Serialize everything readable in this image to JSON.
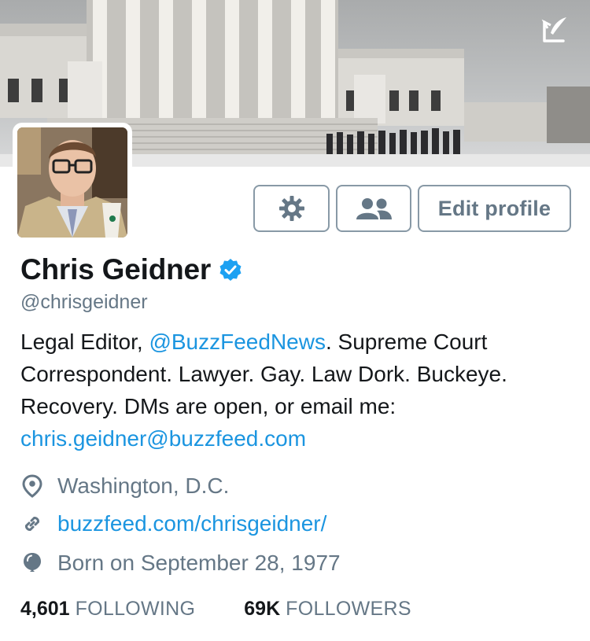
{
  "profile": {
    "name": "Chris Geidner",
    "handle": "@chrisgeidner",
    "bio": {
      "part1": "Legal Editor, ",
      "mention": "@BuzzFeedNews",
      "part2": ". Supreme Court Correspondent. Lawyer. Gay. Law Dork. Buckeye. Recovery. DMs are open, or email me: ",
      "email": "chris.geidner@buzzfeed.com"
    },
    "location": "Washington, D.C.",
    "url": "buzzfeed.com/chrisgeidner/",
    "birthday": "Born on September 28, 1977"
  },
  "actions": {
    "edit_profile": "Edit profile"
  },
  "stats": {
    "following_count": "4,601",
    "following_label": "FOLLOWING",
    "followers_count": "69K",
    "followers_label": "FOLLOWERS"
  },
  "icons": {
    "compose": "compose-icon",
    "settings": "gear-icon",
    "lists": "people-icon",
    "verified": "verified-badge-icon",
    "location": "location-pin-icon",
    "url": "link-icon",
    "birthday": "balloon-icon"
  },
  "colors": {
    "link": "#1b95e0",
    "secondary_text": "#657786",
    "primary_text": "#14171a",
    "border": "#8899a6"
  }
}
